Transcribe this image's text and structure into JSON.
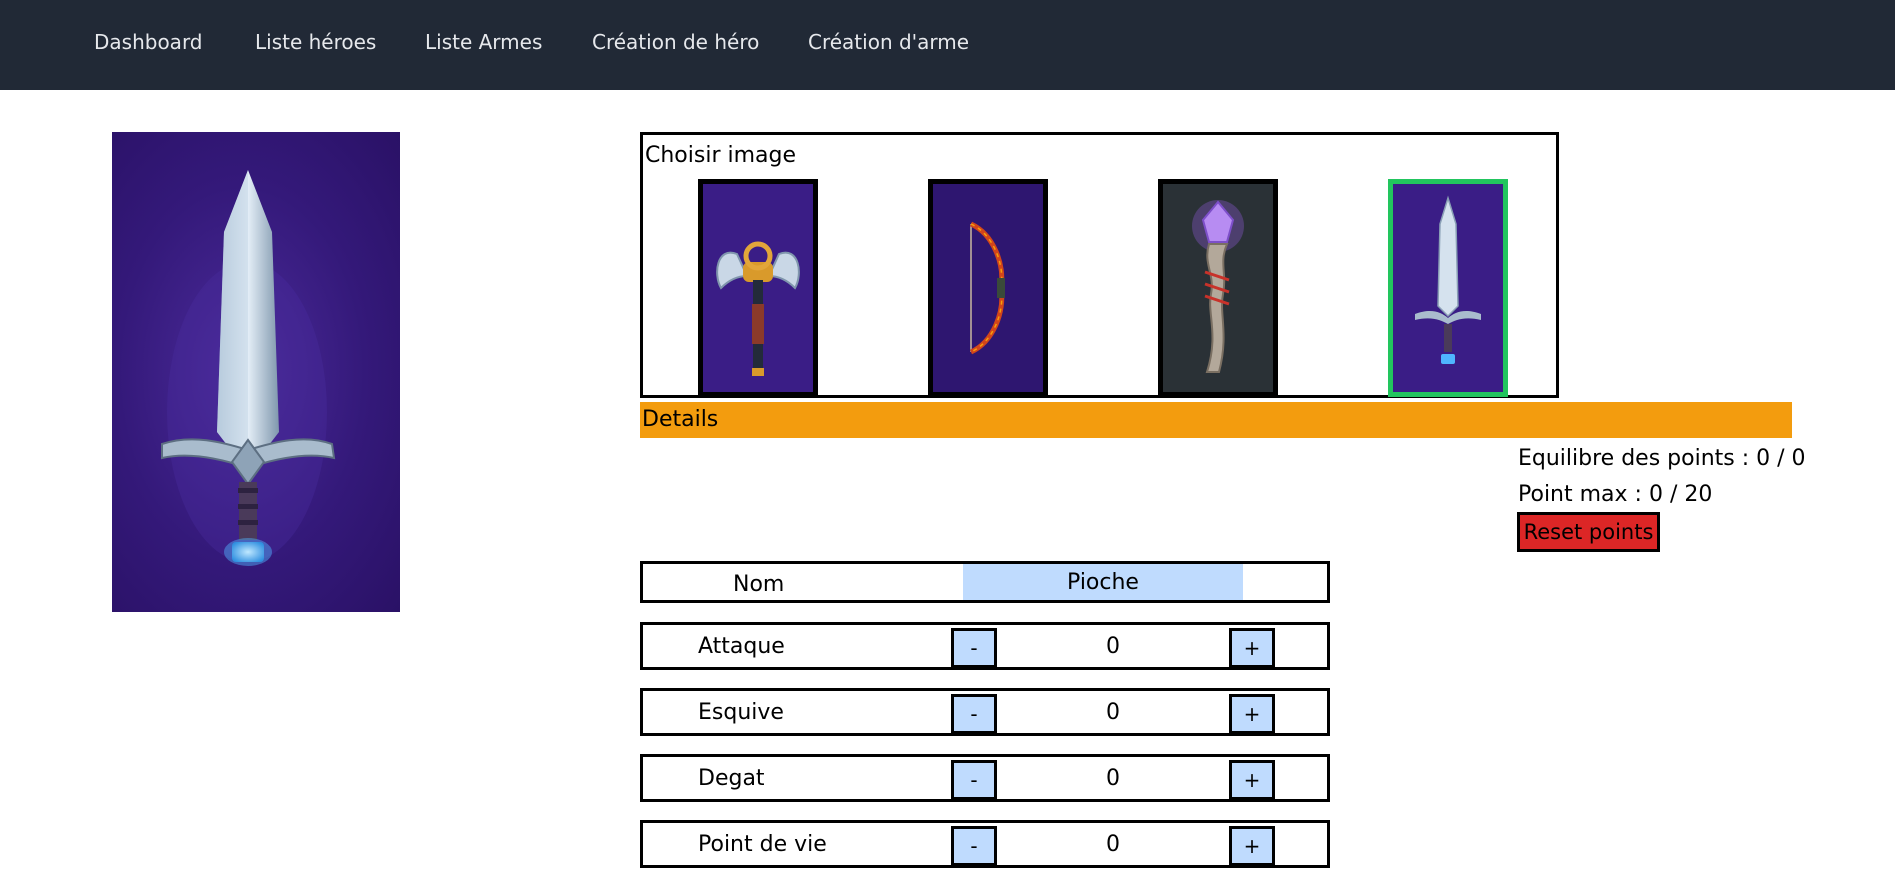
{
  "nav": {
    "items": [
      {
        "label": "Dashboard"
      },
      {
        "label": "Liste héroes"
      },
      {
        "label": "Liste Armes"
      },
      {
        "label": "Création de héro"
      },
      {
        "label": "Création d'arme"
      }
    ]
  },
  "preview": {
    "icon": "sword-icon"
  },
  "picker": {
    "title": "Choisir image",
    "images": [
      {
        "icon": "double-axe-icon",
        "selected": false
      },
      {
        "icon": "bow-icon",
        "selected": false
      },
      {
        "icon": "magic-staff-icon",
        "selected": false
      },
      {
        "icon": "sword-icon",
        "selected": true
      }
    ]
  },
  "details": {
    "label": "Details"
  },
  "points": {
    "balance": "Equilibre des points : 0 / 0",
    "max": "Point max : 0 / 20",
    "reset_label": "Reset points"
  },
  "name_field": {
    "label": "Nom",
    "value": "Pioche"
  },
  "stats": [
    {
      "label": "Attaque",
      "value": "0",
      "minus": "-",
      "plus": "+"
    },
    {
      "label": "Esquive",
      "value": "0",
      "minus": "-",
      "plus": "+"
    },
    {
      "label": "Degat",
      "value": "0",
      "minus": "-",
      "plus": "+"
    },
    {
      "label": "Point de vie",
      "value": "0",
      "minus": "-",
      "plus": "+"
    }
  ],
  "colors": {
    "nav_bg": "#212936",
    "details_bar": "#f39c0e",
    "reset_button": "#dc2626",
    "selected_border": "#22c55e",
    "input_bg": "#bfdbfe"
  }
}
